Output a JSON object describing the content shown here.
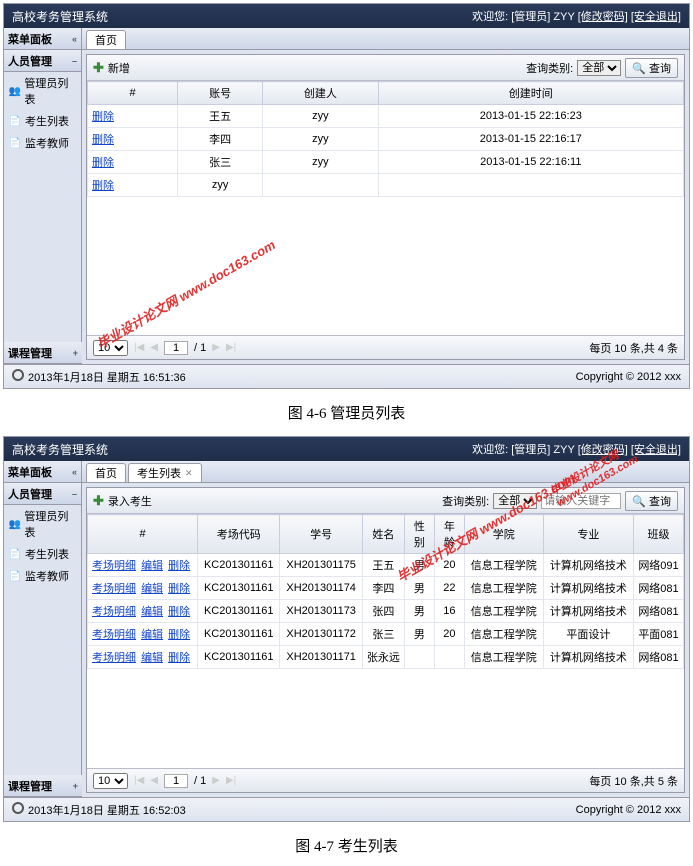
{
  "app_title": "高校考务管理系统",
  "welcome_prefix": "欢迎您:",
  "role": "[管理员]",
  "user": "ZYY",
  "change_pw": "[修改密码]",
  "logout": "[安全退出]",
  "menu_panel": "菜单面板",
  "person_mgmt": "人员管理",
  "course_mgmt": "课程管理",
  "side_items": [
    "管理员列表",
    "考生列表",
    "监考教师"
  ],
  "tab_home": "首页",
  "tab_students": "考生列表",
  "btn_add": "新增",
  "btn_import": "录入考生",
  "query_label": "查询类别:",
  "query_all": "全部",
  "search_placeholder": "请输入关键字",
  "btn_search": "查询",
  "cols1": {
    "op": "#",
    "acct": "账号",
    "creator": "创建人",
    "ctime": "创建时间"
  },
  "rows1": [
    {
      "op": "删除",
      "acct": "王五",
      "creator": "zyy",
      "ctime": "2013-01-15 22:16:23"
    },
    {
      "op": "删除",
      "acct": "李四",
      "creator": "zyy",
      "ctime": "2013-01-15 22:16:17"
    },
    {
      "op": "删除",
      "acct": "张三",
      "creator": "zyy",
      "ctime": "2013-01-15 22:16:11"
    },
    {
      "op": "删除",
      "acct": "zyy",
      "creator": "",
      "ctime": ""
    }
  ],
  "cols2": {
    "op": "#",
    "room": "考场代码",
    "sid": "学号",
    "name": "姓名",
    "sex": "性别",
    "age": "年龄",
    "college": "学院",
    "major": "专业",
    "cls": "班级"
  },
  "rows2": [
    {
      "op": [
        "考场明细",
        "编辑",
        "删除"
      ],
      "room": "KC201301161",
      "sid": "XH201301175",
      "name": "王五",
      "sex": "男",
      "age": "20",
      "college": "信息工程学院",
      "major": "计算机网络技术",
      "cls": "网络091"
    },
    {
      "op": [
        "考场明细",
        "编辑",
        "删除"
      ],
      "room": "KC201301161",
      "sid": "XH201301174",
      "name": "李四",
      "sex": "男",
      "age": "22",
      "college": "信息工程学院",
      "major": "计算机网络技术",
      "cls": "网络081"
    },
    {
      "op": [
        "考场明细",
        "编辑",
        "删除"
      ],
      "room": "KC201301161",
      "sid": "XH201301173",
      "name": "张四",
      "sex": "男",
      "age": "16",
      "college": "信息工程学院",
      "major": "计算机网络技术",
      "cls": "网络081"
    },
    {
      "op": [
        "考场明细",
        "编辑",
        "删除"
      ],
      "room": "KC201301161",
      "sid": "XH201301172",
      "name": "张三",
      "sex": "男",
      "age": "20",
      "college": "信息工程学院",
      "major": "平面设计",
      "cls": "平面081"
    },
    {
      "op": [
        "考场明细",
        "编辑",
        "删除"
      ],
      "room": "KC201301161",
      "sid": "XH201301171",
      "name": "张永远",
      "sex": "",
      "age": "",
      "college": "信息工程学院",
      "major": "计算机网络技术",
      "cls": "网络081"
    }
  ],
  "page_size": "10",
  "page_cur": "1",
  "page_total": "/ 1",
  "page_info1": "每页 10 条,共 4 条",
  "page_info2": "每页 10 条,共 5 条",
  "footer_time1": "2013年1月18日 星期五 16:51:36",
  "footer_time2": "2013年1月18日 星期五 16:52:03",
  "copyright": "Copyright © 2012 xxx",
  "caption1": "图 4-6 管理员列表",
  "caption2": "图 4-7 考生列表",
  "watermark": "毕业设计论文网  www.doc163.com"
}
